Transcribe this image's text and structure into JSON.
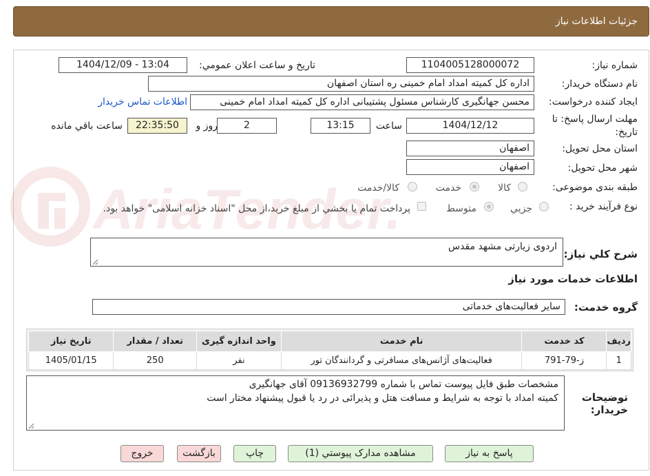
{
  "header": {
    "title": "جزئیات اطلاعات نیاز"
  },
  "form": {
    "need_number_label": "شماره نیاز:",
    "need_number": "1104005128000072",
    "announce_label": "تاریخ و ساعت اعلان عمومي:",
    "announce_value": "1404/12/09 - 13:04",
    "buyer_label": "نام دستگاه خريدار:",
    "buyer_value": "اداره کل کمیته امداد امام خمینی  ره  استان اصفهان",
    "creator_label": "ايجاد كننده درخواست:",
    "creator_value": "محسن جهانگیری کارشناس مسئول پشتیبانی اداره کل کمیته امداد امام خمینی",
    "contact_link": "اطلاعات تماس خريدار",
    "deadline_label_1": "مهلت ارسال پاسخ: تا",
    "deadline_label_2": "تاريخ:",
    "deadline_date": "1404/12/12",
    "time_label": "ساعت",
    "deadline_time": "13:15",
    "days_value": "2",
    "days_label": "روز و",
    "remaining_time": "22:35:50",
    "remaining_label": "ساعت باقي مانده",
    "province_label": "استان محل تحويل:",
    "province_value": "اصفهان",
    "city_label": "شهر محل تحويل:",
    "city_value": "اصفهان",
    "category_label": "طبقه بندی موضوعی:",
    "category_options": [
      "كالا",
      "خدمت",
      "كالا/خدمت"
    ],
    "category_selected": "خدمت",
    "purchase_type_label": "نوع فرآيند خريد :",
    "purchase_options": [
      "جزيي",
      "متوسط"
    ],
    "purchase_selected": "متوسط",
    "payment_note": "پرداخت تمام يا بخشي از مبلغ خريد،از محل \"اسناد خزانه اسلامی\" خواهد بود."
  },
  "description": {
    "label": "شرح كلي نياز:",
    "value": "اردوی زیارتی مشهد مقدس"
  },
  "services": {
    "section_title": "اطلاعات خدمات مورد نياز",
    "group_label": "گروه خدمت:",
    "group_value": "سایر فعالیت‌های خدماتی",
    "columns": [
      "رديف",
      "كد خدمت",
      "نام خدمت",
      "واحد اندازه گيری",
      "تعداد / مقدار",
      "تاريخ نياز"
    ],
    "rows": [
      [
        "1",
        "ز-79-791",
        "فعالیت‌های آژانس‌های مسافرتی و گردانندگان تور",
        "نفر",
        "250",
        "1405/01/15"
      ]
    ]
  },
  "buyer_notes": {
    "label_1": "توضيحات",
    "label_2": "خريدار:",
    "line_1": "مشخصات طبق فایل پیوست تماس با شماره 09136932799 آقای جهانگیری",
    "line_2": "کمیته امداد با توجه به شرایط و مسافت هتل و پذیرائی در رد یا قبول پیشنهاد مختار است"
  },
  "buttons": {
    "respond": "پاسخ به نياز",
    "attachments": "مشاهده مدارک پيوستي (1)",
    "print": "چاپ",
    "back": "بازگشت",
    "exit": "خروج"
  },
  "watermark": {
    "text": "AriaTender.neT"
  },
  "colors": {
    "header": "#8f6a3f",
    "link": "#1a56c8",
    "highlight": "#f6f3cf",
    "green_button": "#dff3d8",
    "pink_button": "#f9d8d8"
  }
}
